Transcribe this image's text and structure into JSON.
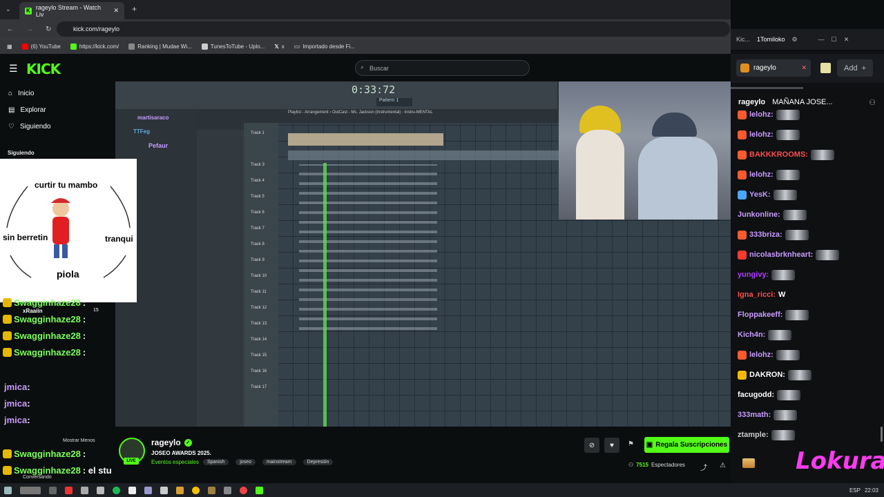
{
  "browser": {
    "tab_title": "rageylo Stream - Watch Liv",
    "url": "kick.com/rageylo",
    "bookmarks": [
      "(6) YouTube",
      "https://kick.com/",
      "Ranking | Mudae Wi...",
      "TunesToTube - Uplo...",
      "x",
      "Importado desde Fi..."
    ]
  },
  "site": {
    "logo": "KICK",
    "search_placeholder": "Buscar",
    "nav": [
      "Inicio",
      "Explorar",
      "Siguiendo"
    ],
    "following_label": "Siguiendo"
  },
  "overlay": {
    "top": "curtir tu mambo",
    "left": "sin berretin",
    "right": "tranqui",
    "bottom": "piola"
  },
  "left_chat": [
    {
      "user": "Swagginhaze28",
      "text": ":"
    },
    {
      "user": "Swagginhaze28",
      "text": ":"
    },
    {
      "user": "Swagginhaze28",
      "text": ":"
    },
    {
      "user": "Swagginhaze28",
      "text": ":"
    },
    {
      "user": "jmica",
      "text": ":"
    },
    {
      "user": "jmica",
      "text": ":"
    },
    {
      "user": "jmica",
      "text": ":"
    },
    {
      "user": "jmica",
      "text": ":"
    },
    {
      "user": "Swagginhaze28",
      "text": ":"
    },
    {
      "user": "Swagginhaze28",
      "text": ": el stu"
    },
    {
      "user": "jmica",
      "text": ":"
    }
  ],
  "small_labels": {
    "raider": "xRaaiin",
    "raider_count": "15",
    "show_less": "Mostrar Menos",
    "conversation": "Conversando"
  },
  "fl": {
    "time": "0:33:72",
    "pattern": "Pattern 1",
    "playlist_title": "Playlist - Arrangement › OutCast - Ms. Jackson (Instrumental) - Instru-MENTAL",
    "tracks": [
      "Track 1",
      "Track 3",
      "Track 4",
      "Track 5",
      "Track 6",
      "Track 7",
      "Track 8",
      "Track 9",
      "Track 10",
      "Track 11",
      "Track 12",
      "Track 13",
      "Track 14",
      "Track 15",
      "Track 16",
      "Track 17"
    ],
    "chat_users": [
      {
        "name": "martisaraco"
      },
      {
        "name": "TTFeg"
      },
      {
        "name": "Pefaur"
      }
    ]
  },
  "streamer": {
    "name": "rageylo",
    "title": "JOSEO AWARDS 2025.",
    "category": "Eventos especiales",
    "tags": [
      "Spanish",
      "joseo",
      "mainstream",
      "Depresión"
    ],
    "live_label": "LIVE",
    "viewers": "7515",
    "viewers_label": "Espectadores",
    "subscribe_label": "Regala Suscripciones"
  },
  "right_panel": {
    "window_title_short": "Kic...",
    "window_title": "1Tomiloko",
    "channel_tab": "rageylo",
    "add_label": "Add",
    "header_user": "rageylo",
    "header_text": "MAÑANA JOSE...",
    "lokura": "Lokura",
    "messages": [
      {
        "user": "lelohz:",
        "color": "#c99bff",
        "badge": "#ff5a2e"
      },
      {
        "user": "lelohz:",
        "color": "#c99bff",
        "badge": "#ff5a2e"
      },
      {
        "user": "BAKKKROOMS:",
        "color": "#ff4d4d",
        "badge": "#ff5a2e"
      },
      {
        "user": "lelohz:",
        "color": "#c99bff",
        "badge": "#ff5a2e"
      },
      {
        "user": "YesK:",
        "color": "#c99bff",
        "badge": "#4aa8ff"
      },
      {
        "user": "Junkonline:",
        "color": "#c99bff",
        "badge": ""
      },
      {
        "user": "333briza:",
        "color": "#c99bff",
        "badge": "#ff5a2e"
      },
      {
        "user": "nicolasbrknheart:",
        "color": "#c99bff",
        "badge": "#ff3a2e"
      },
      {
        "user": "yungivy:",
        "color": "#b23cff",
        "badge": ""
      },
      {
        "user": "Igna_ricci:",
        "color": "#ff4d4d",
        "badge": "",
        "text": "W"
      },
      {
        "user": "Floppakeeff:",
        "color": "#c99bff",
        "badge": ""
      },
      {
        "user": "Kich4n:",
        "color": "#c99bff",
        "badge": ""
      },
      {
        "user": "lelohz:",
        "color": "#c99bff",
        "badge": "#ff5a2e"
      },
      {
        "user": "DAKRON:",
        "color": "#ffffff",
        "badge": "#f5b800"
      },
      {
        "user": "facugodd:",
        "color": "#ffffff",
        "badge": ""
      },
      {
        "user": "333math:",
        "color": "#c99bff",
        "badge": ""
      },
      {
        "user": "ztample:",
        "color": "#cccccc",
        "badge": ""
      }
    ]
  },
  "taskbar": {
    "lang": "ESP",
    "time": "22:03"
  }
}
